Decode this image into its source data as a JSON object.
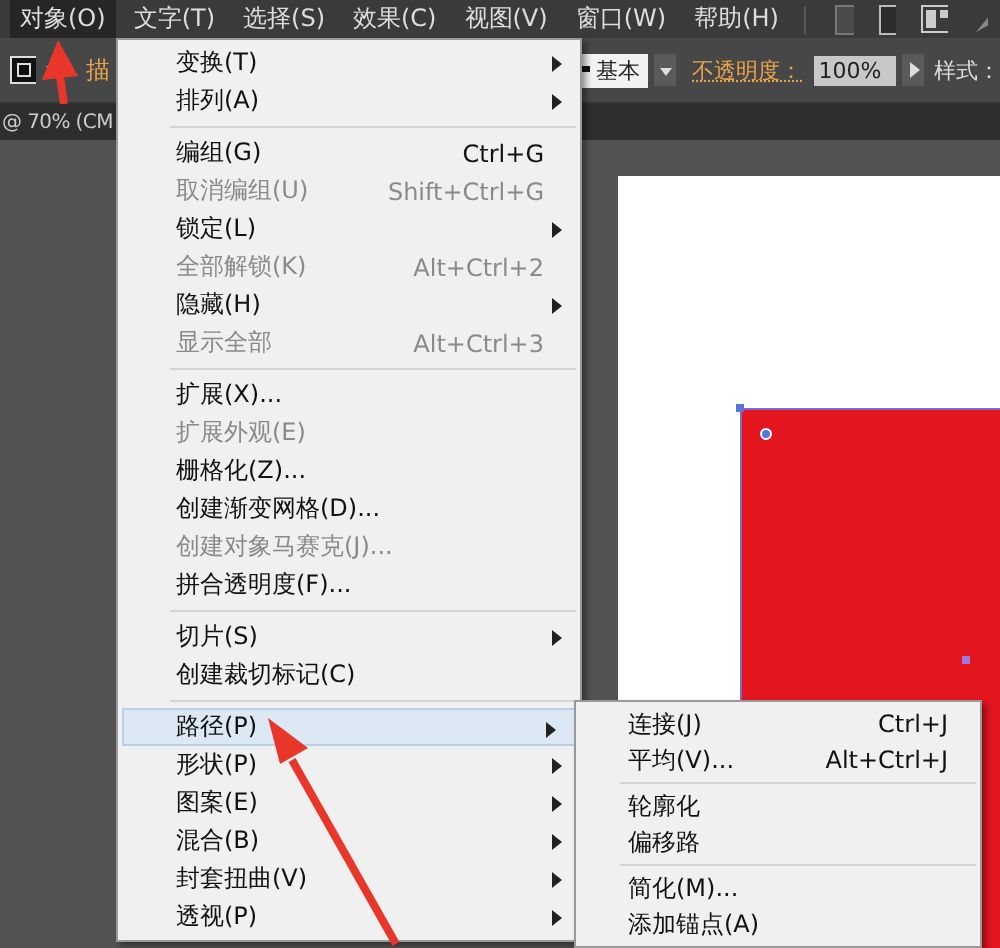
{
  "menubar": [
    {
      "label": "对象(O)",
      "selected": true
    },
    {
      "label": "文字(T)",
      "selected": false
    },
    {
      "label": "选择(S)",
      "selected": false
    },
    {
      "label": "效果(C)",
      "selected": false
    },
    {
      "label": "视图(V)",
      "selected": false
    },
    {
      "label": "窗口(W)",
      "selected": false
    },
    {
      "label": "帮助(H)",
      "selected": false
    }
  ],
  "control_bar": {
    "stroke_label": "描",
    "brush_value": "基本",
    "opacity_label": "不透明度：",
    "opacity_value": "100%",
    "style_label": "样式："
  },
  "document_tab": {
    "title": "@ 70% (CM"
  },
  "object_menu": [
    {
      "kind": "item",
      "label": "变换(T)",
      "submenu": true,
      "disabled": false,
      "selected": false
    },
    {
      "kind": "item",
      "label": "排列(A)",
      "submenu": true,
      "disabled": false,
      "selected": false
    },
    {
      "kind": "separator"
    },
    {
      "kind": "item",
      "label": "编组(G)",
      "shortcut": "Ctrl+G",
      "submenu": false,
      "disabled": false,
      "selected": false
    },
    {
      "kind": "item",
      "label": "取消编组(U)",
      "shortcut": "Shift+Ctrl+G",
      "submenu": false,
      "disabled": true,
      "selected": false
    },
    {
      "kind": "item",
      "label": "锁定(L)",
      "submenu": true,
      "disabled": false,
      "selected": false
    },
    {
      "kind": "item",
      "label": "全部解锁(K)",
      "shortcut": "Alt+Ctrl+2",
      "submenu": false,
      "disabled": true,
      "selected": false
    },
    {
      "kind": "item",
      "label": "隐藏(H)",
      "submenu": true,
      "disabled": false,
      "selected": false
    },
    {
      "kind": "item",
      "label": "显示全部",
      "shortcut": "Alt+Ctrl+3",
      "submenu": false,
      "disabled": true,
      "selected": false
    },
    {
      "kind": "separator"
    },
    {
      "kind": "item",
      "label": "扩展(X)...",
      "submenu": false,
      "disabled": false,
      "selected": false
    },
    {
      "kind": "item",
      "label": "扩展外观(E)",
      "submenu": false,
      "disabled": true,
      "selected": false
    },
    {
      "kind": "item",
      "label": "栅格化(Z)...",
      "submenu": false,
      "disabled": false,
      "selected": false
    },
    {
      "kind": "item",
      "label": "创建渐变网格(D)...",
      "submenu": false,
      "disabled": false,
      "selected": false
    },
    {
      "kind": "item",
      "label": "创建对象马赛克(J)...",
      "submenu": false,
      "disabled": true,
      "selected": false
    },
    {
      "kind": "item",
      "label": "拼合透明度(F)...",
      "submenu": false,
      "disabled": false,
      "selected": false
    },
    {
      "kind": "separator"
    },
    {
      "kind": "item",
      "label": "切片(S)",
      "submenu": true,
      "disabled": false,
      "selected": false
    },
    {
      "kind": "item",
      "label": "创建裁切标记(C)",
      "submenu": false,
      "disabled": false,
      "selected": false
    },
    {
      "kind": "separator"
    },
    {
      "kind": "item",
      "label": "路径(P)",
      "submenu": true,
      "disabled": false,
      "selected": true
    },
    {
      "kind": "item",
      "label": "形状(P)",
      "submenu": true,
      "disabled": false,
      "selected": false
    },
    {
      "kind": "item",
      "label": "图案(E)",
      "submenu": true,
      "disabled": false,
      "selected": false
    },
    {
      "kind": "item",
      "label": "混合(B)",
      "submenu": true,
      "disabled": false,
      "selected": false
    },
    {
      "kind": "item",
      "label": "封套扭曲(V)",
      "submenu": true,
      "disabled": false,
      "selected": false
    },
    {
      "kind": "item",
      "label": "透视(P)",
      "submenu": true,
      "disabled": false,
      "selected": false
    }
  ],
  "path_submenu": [
    {
      "kind": "item",
      "label": "连接(J)",
      "shortcut": "Ctrl+J"
    },
    {
      "kind": "item",
      "label": "平均(V)...",
      "shortcut": "Alt+Ctrl+J"
    },
    {
      "kind": "separator"
    },
    {
      "kind": "item",
      "label": "轮廓化"
    },
    {
      "kind": "item",
      "label": "偏移路"
    },
    {
      "kind": "separator"
    },
    {
      "kind": "item",
      "label": "简化(M)..."
    },
    {
      "kind": "item",
      "label": "添加锚点(A)"
    }
  ]
}
